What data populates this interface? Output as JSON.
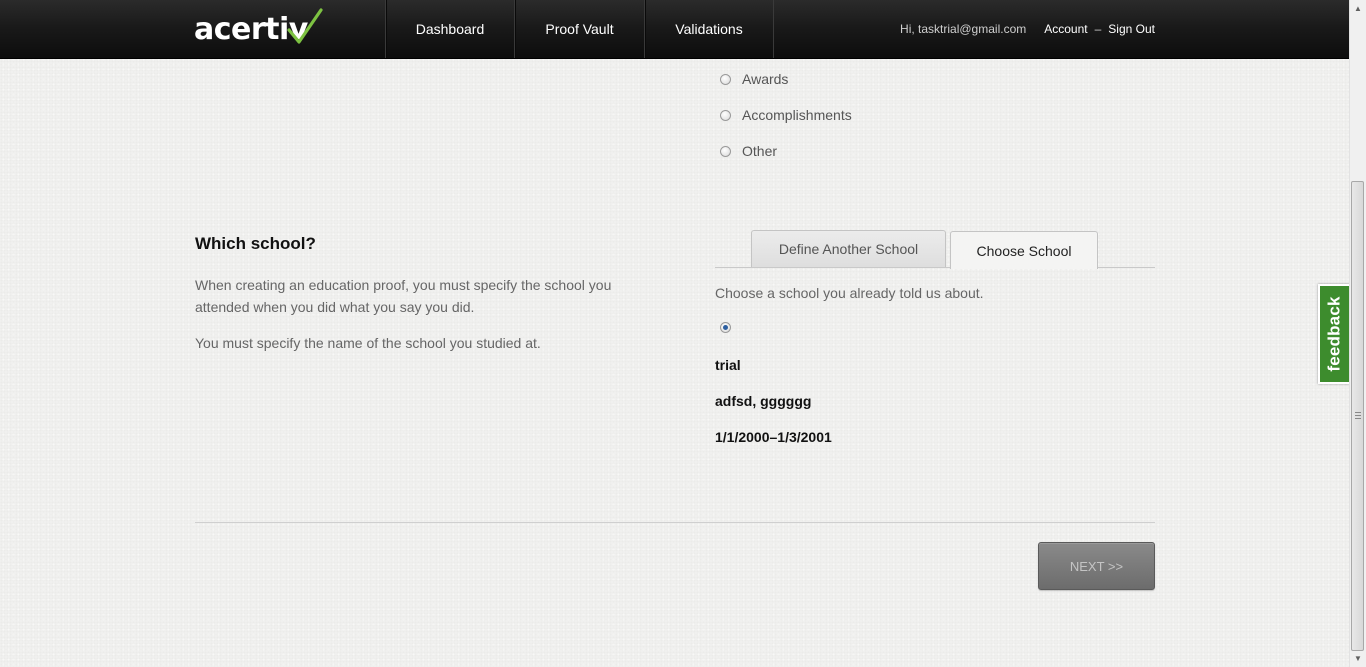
{
  "header": {
    "logo_text": "acertiv",
    "nav": [
      {
        "label": "Dashboard"
      },
      {
        "label": "Proof Vault"
      },
      {
        "label": "Validations"
      }
    ],
    "greeting": "Hi, tasktrial@gmail.com",
    "account_label": "Account",
    "separator": "–",
    "signout_label": "Sign Out"
  },
  "category_options": [
    {
      "label": "Awards",
      "checked": false
    },
    {
      "label": "Accomplishments",
      "checked": false
    },
    {
      "label": "Other",
      "checked": false
    }
  ],
  "school_section": {
    "title": "Which school?",
    "description_1": "When creating an education proof, you must specify the school you attended when you did what you say you did.",
    "description_2": "You must specify the name of the school you studied at.",
    "tabs": [
      {
        "label": "Define Another School",
        "active": false
      },
      {
        "label": "Choose School",
        "active": true
      }
    ],
    "choose_prompt": "Choose a school you already told us about.",
    "school": {
      "selected": true,
      "name": "trial",
      "location": "adfsd, gggggg",
      "dates": "1/1/2000–1/3/2001"
    }
  },
  "next_button_label": "NEXT >>",
  "feedback_label": "feedback",
  "colors": {
    "feedback_green": "#3d8c2d",
    "logo_check_green": "#7dc242",
    "topbar_dark": "#1a1a1a"
  }
}
